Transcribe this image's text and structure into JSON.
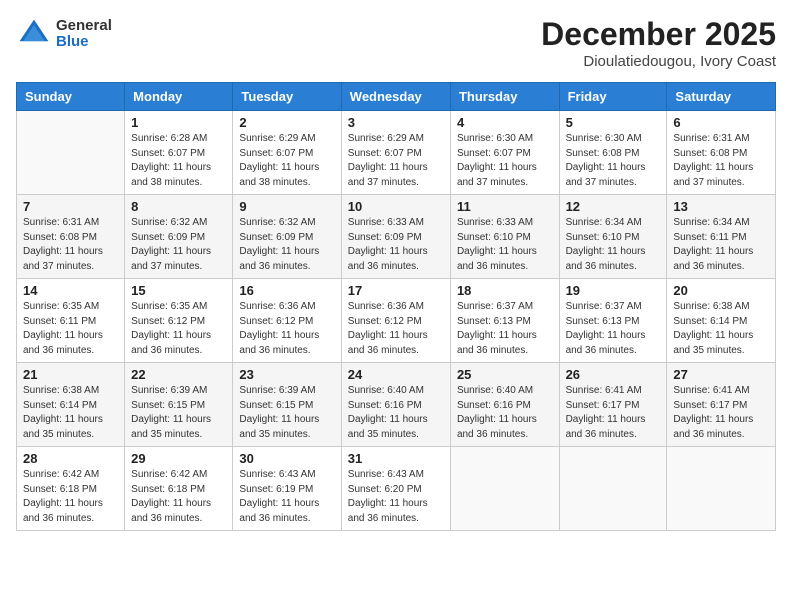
{
  "header": {
    "logo_line1": "General",
    "logo_line2": "Blue",
    "title": "December 2025",
    "subtitle": "Dioulatiedougou, Ivory Coast"
  },
  "columns": [
    "Sunday",
    "Monday",
    "Tuesday",
    "Wednesday",
    "Thursday",
    "Friday",
    "Saturday"
  ],
  "weeks": [
    [
      {
        "day": "",
        "empty": true
      },
      {
        "day": "1",
        "sunrise": "Sunrise: 6:28 AM",
        "sunset": "Sunset: 6:07 PM",
        "daylight": "Daylight: 11 hours and 38 minutes."
      },
      {
        "day": "2",
        "sunrise": "Sunrise: 6:29 AM",
        "sunset": "Sunset: 6:07 PM",
        "daylight": "Daylight: 11 hours and 38 minutes."
      },
      {
        "day": "3",
        "sunrise": "Sunrise: 6:29 AM",
        "sunset": "Sunset: 6:07 PM",
        "daylight": "Daylight: 11 hours and 37 minutes."
      },
      {
        "day": "4",
        "sunrise": "Sunrise: 6:30 AM",
        "sunset": "Sunset: 6:07 PM",
        "daylight": "Daylight: 11 hours and 37 minutes."
      },
      {
        "day": "5",
        "sunrise": "Sunrise: 6:30 AM",
        "sunset": "Sunset: 6:08 PM",
        "daylight": "Daylight: 11 hours and 37 minutes."
      },
      {
        "day": "6",
        "sunrise": "Sunrise: 6:31 AM",
        "sunset": "Sunset: 6:08 PM",
        "daylight": "Daylight: 11 hours and 37 minutes."
      }
    ],
    [
      {
        "day": "7",
        "sunrise": "Sunrise: 6:31 AM",
        "sunset": "Sunset: 6:08 PM",
        "daylight": "Daylight: 11 hours and 37 minutes."
      },
      {
        "day": "8",
        "sunrise": "Sunrise: 6:32 AM",
        "sunset": "Sunset: 6:09 PM",
        "daylight": "Daylight: 11 hours and 37 minutes."
      },
      {
        "day": "9",
        "sunrise": "Sunrise: 6:32 AM",
        "sunset": "Sunset: 6:09 PM",
        "daylight": "Daylight: 11 hours and 36 minutes."
      },
      {
        "day": "10",
        "sunrise": "Sunrise: 6:33 AM",
        "sunset": "Sunset: 6:09 PM",
        "daylight": "Daylight: 11 hours and 36 minutes."
      },
      {
        "day": "11",
        "sunrise": "Sunrise: 6:33 AM",
        "sunset": "Sunset: 6:10 PM",
        "daylight": "Daylight: 11 hours and 36 minutes."
      },
      {
        "day": "12",
        "sunrise": "Sunrise: 6:34 AM",
        "sunset": "Sunset: 6:10 PM",
        "daylight": "Daylight: 11 hours and 36 minutes."
      },
      {
        "day": "13",
        "sunrise": "Sunrise: 6:34 AM",
        "sunset": "Sunset: 6:11 PM",
        "daylight": "Daylight: 11 hours and 36 minutes."
      }
    ],
    [
      {
        "day": "14",
        "sunrise": "Sunrise: 6:35 AM",
        "sunset": "Sunset: 6:11 PM",
        "daylight": "Daylight: 11 hours and 36 minutes."
      },
      {
        "day": "15",
        "sunrise": "Sunrise: 6:35 AM",
        "sunset": "Sunset: 6:12 PM",
        "daylight": "Daylight: 11 hours and 36 minutes."
      },
      {
        "day": "16",
        "sunrise": "Sunrise: 6:36 AM",
        "sunset": "Sunset: 6:12 PM",
        "daylight": "Daylight: 11 hours and 36 minutes."
      },
      {
        "day": "17",
        "sunrise": "Sunrise: 6:36 AM",
        "sunset": "Sunset: 6:12 PM",
        "daylight": "Daylight: 11 hours and 36 minutes."
      },
      {
        "day": "18",
        "sunrise": "Sunrise: 6:37 AM",
        "sunset": "Sunset: 6:13 PM",
        "daylight": "Daylight: 11 hours and 36 minutes."
      },
      {
        "day": "19",
        "sunrise": "Sunrise: 6:37 AM",
        "sunset": "Sunset: 6:13 PM",
        "daylight": "Daylight: 11 hours and 36 minutes."
      },
      {
        "day": "20",
        "sunrise": "Sunrise: 6:38 AM",
        "sunset": "Sunset: 6:14 PM",
        "daylight": "Daylight: 11 hours and 35 minutes."
      }
    ],
    [
      {
        "day": "21",
        "sunrise": "Sunrise: 6:38 AM",
        "sunset": "Sunset: 6:14 PM",
        "daylight": "Daylight: 11 hours and 35 minutes."
      },
      {
        "day": "22",
        "sunrise": "Sunrise: 6:39 AM",
        "sunset": "Sunset: 6:15 PM",
        "daylight": "Daylight: 11 hours and 35 minutes."
      },
      {
        "day": "23",
        "sunrise": "Sunrise: 6:39 AM",
        "sunset": "Sunset: 6:15 PM",
        "daylight": "Daylight: 11 hours and 35 minutes."
      },
      {
        "day": "24",
        "sunrise": "Sunrise: 6:40 AM",
        "sunset": "Sunset: 6:16 PM",
        "daylight": "Daylight: 11 hours and 35 minutes."
      },
      {
        "day": "25",
        "sunrise": "Sunrise: 6:40 AM",
        "sunset": "Sunset: 6:16 PM",
        "daylight": "Daylight: 11 hours and 36 minutes."
      },
      {
        "day": "26",
        "sunrise": "Sunrise: 6:41 AM",
        "sunset": "Sunset: 6:17 PM",
        "daylight": "Daylight: 11 hours and 36 minutes."
      },
      {
        "day": "27",
        "sunrise": "Sunrise: 6:41 AM",
        "sunset": "Sunset: 6:17 PM",
        "daylight": "Daylight: 11 hours and 36 minutes."
      }
    ],
    [
      {
        "day": "28",
        "sunrise": "Sunrise: 6:42 AM",
        "sunset": "Sunset: 6:18 PM",
        "daylight": "Daylight: 11 hours and 36 minutes."
      },
      {
        "day": "29",
        "sunrise": "Sunrise: 6:42 AM",
        "sunset": "Sunset: 6:18 PM",
        "daylight": "Daylight: 11 hours and 36 minutes."
      },
      {
        "day": "30",
        "sunrise": "Sunrise: 6:43 AM",
        "sunset": "Sunset: 6:19 PM",
        "daylight": "Daylight: 11 hours and 36 minutes."
      },
      {
        "day": "31",
        "sunrise": "Sunrise: 6:43 AM",
        "sunset": "Sunset: 6:20 PM",
        "daylight": "Daylight: 11 hours and 36 minutes."
      },
      {
        "day": "",
        "empty": true
      },
      {
        "day": "",
        "empty": true
      },
      {
        "day": "",
        "empty": true
      }
    ]
  ]
}
